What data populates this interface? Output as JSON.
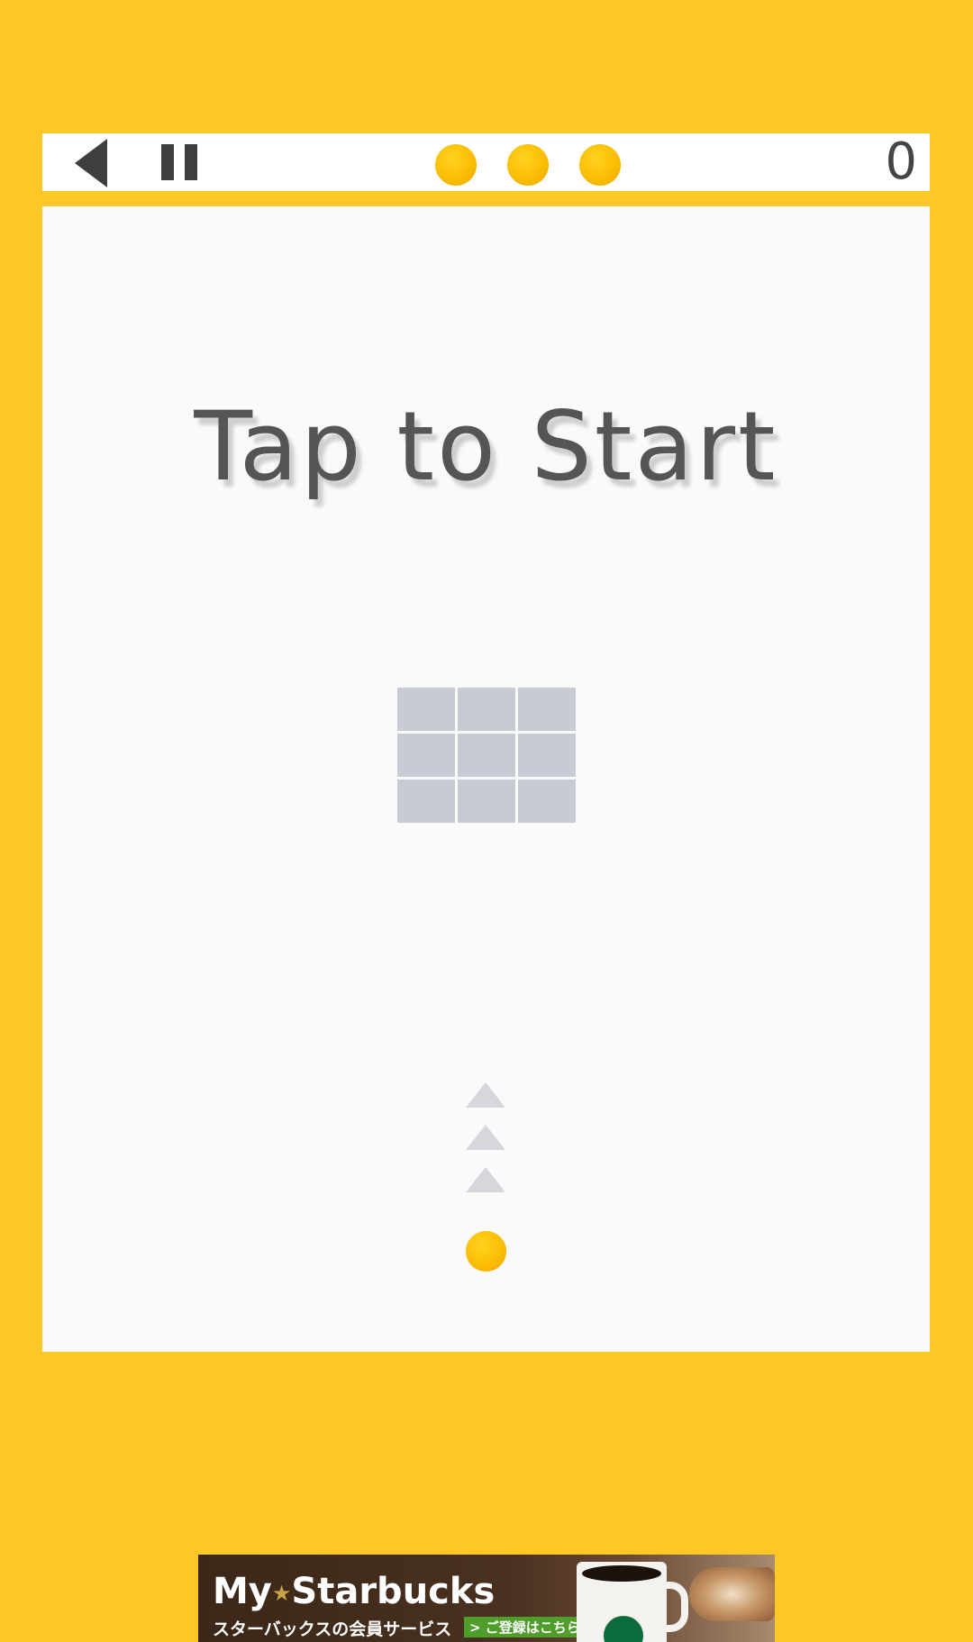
{
  "header": {
    "back_icon": "back-arrow-icon",
    "pause_icon": "pause-icon",
    "lives": [
      {
        "icon": "life-ball-icon"
      },
      {
        "icon": "life-ball-icon"
      },
      {
        "icon": "life-ball-icon"
      }
    ],
    "score": "0"
  },
  "board": {
    "prompt": "Tap to Start",
    "grid": {
      "rows": 3,
      "cols": 3,
      "icon": "target-grid"
    },
    "arrows": [
      "up-arrow-icon",
      "up-arrow-icon",
      "up-arrow-icon"
    ],
    "player_icon": "player-ball-icon"
  },
  "ad": {
    "title_part1": "My",
    "title_star": "★",
    "title_part2": "Starbucks",
    "subtitle": "スターバックスの会員サービス",
    "cta": "> ご登録はこちら"
  },
  "colors": {
    "background": "#fdc727",
    "panel": "#fafafa",
    "ball": "#fcbd05",
    "grid_cell": "#c8cad4",
    "arrow": "#d6d7dd",
    "text": "#555555"
  }
}
